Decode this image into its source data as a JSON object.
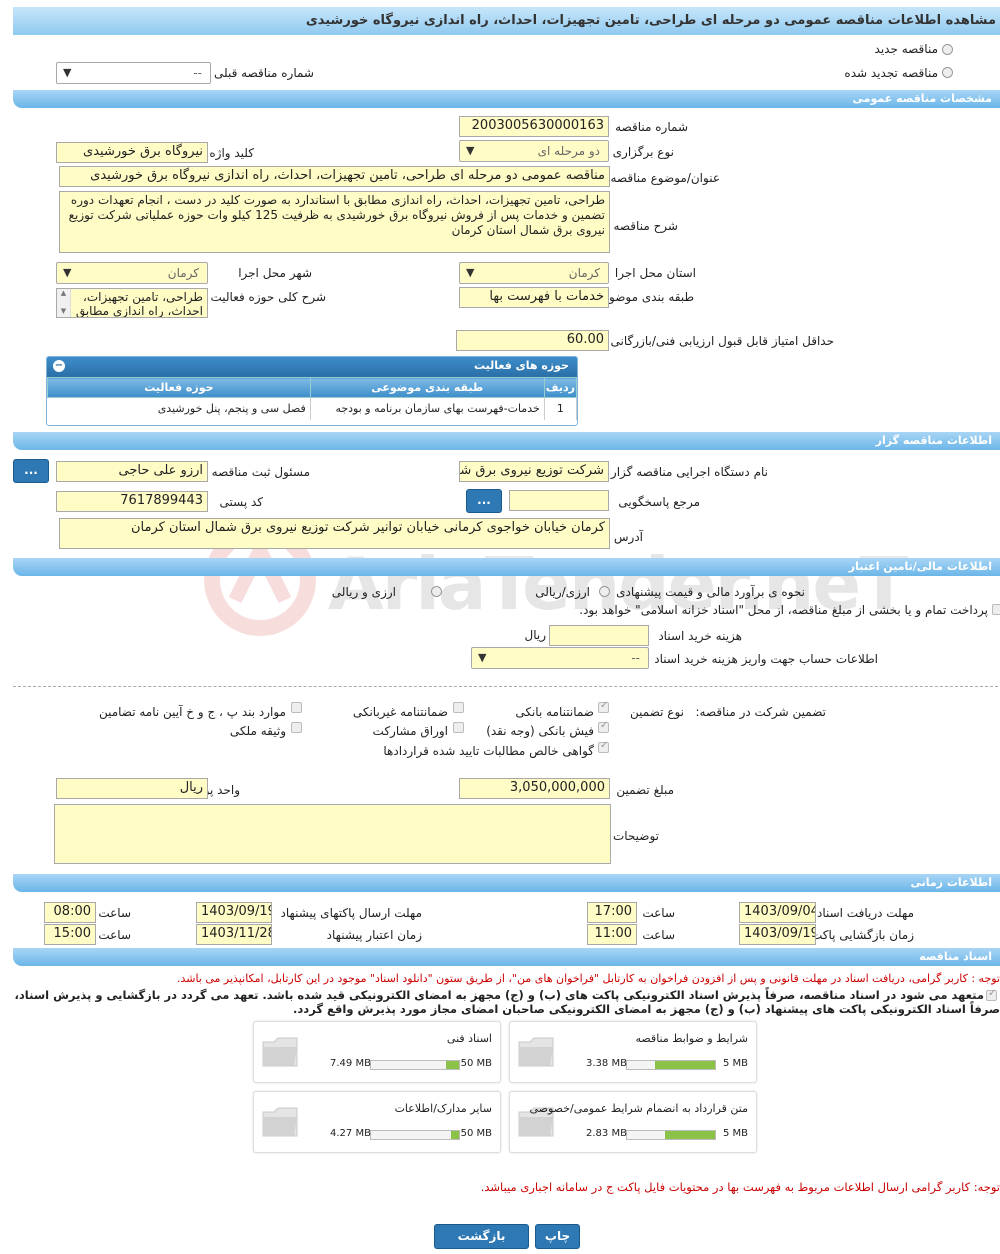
{
  "title": "مشاهده اطلاعات مناقصه عمومی دو مرحله ای طراحی، تامین تجهیزات، احداث، راه اندازی نیروگاه خورشیدی",
  "tender_type": {
    "new": "مناقصه جدید",
    "renewed": "مناقصه تجدید شده",
    "prev_label": "شماره مناقصه قبلی",
    "prev_value": "--"
  },
  "general": {
    "header": "مشخصات مناقصه عمومی",
    "number_label": "شماره مناقصه",
    "number": "2003005630000163",
    "holding_label": "نوع برگزاری",
    "holding": "دو مرحله ای",
    "keyword_label": "کلید واژه",
    "keyword": "نیروگاه برق خورشیدی",
    "subject_label": "عنوان/موضوع مناقصه",
    "subject": "مناقصه عمومی دو مرحله ای طراحی، تامین تجهیزات، احداث، راه اندازی نیروگاه برق خورشیدی",
    "desc_label": "شرح مناقصه",
    "desc": "طراحی، تامین تجهیزات، احداث، راه اندازی مطابق با استاندارد به صورت کلید در دست ، انجام تعهدات دوره تضمین و خدمات پس از فروش نیروگاه برق خورشیدی به ظرفیت 125 کیلو وات حوزه عملیاتی شرکت توزیع نیروی برق شمال استان کرمان",
    "province_label": "استان محل اجرا",
    "province": "کرمان",
    "city_label": "شهر محل اجرا",
    "city": "کرمان",
    "category_label": "طبقه بندی موضوعی",
    "category": "خدمات با فهرست بها",
    "activity_label": "شرح کلی حوزه فعالیت",
    "activity": "طراحی، تامین تجهیزات، احداث، راه اندازی مطابق با",
    "minscore_label": "حداقل امتیاز قابل قبول ارزیابی فنی/بازرگانی",
    "minscore": "60.00"
  },
  "activities": {
    "header": "حوزه های فعالیت",
    "columns": [
      "ردیف",
      "طبقه بندی موضوعی",
      "حوزه فعالیت"
    ],
    "rows": [
      [
        "1",
        "خدمات-فهرست بهای سازمان برنامه و بودجه",
        "فصل سی و پنجم، پنل خورشیدی"
      ]
    ]
  },
  "organizer": {
    "header": "اطلاعات مناقصه گزار",
    "org_label": "نام دستگاه اجرایی مناقصه گزار",
    "org": "شرکت توزیع نیروی برق شمال استان کرمان",
    "resp_label": "مسئول ثبت مناقصه",
    "resp": "ارزو علی حاجی",
    "ref_label": "مرجع پاسخگویی",
    "ref": "",
    "postal_label": "کد پستی",
    "postal": "7617899443",
    "addr_label": "آدرس",
    "addr": "کرمان خیابان خواجوی کرمانی خیابان توانیر شرکت توزیع نیروی برق شمال استان کرمان",
    "btn": "..."
  },
  "finance": {
    "header": "اطلاعات مالی/تامین اعتبار",
    "estimate_label": "نحوه ی برآورد مالی و قیمت پیشنهادی",
    "opt1": "ارزی/ریالی",
    "opt2": "ارزی و ریالی",
    "treasury": "پرداخت تمام و یا بخشی از مبلغ مناقصه، از محل \"اسناد خزانه اسلامی\" خواهد بود.",
    "doc_cost_label": "هزینه خرید اسناد",
    "doc_cost_unit": "ریال",
    "account_label": "اطلاعات حساب جهت واریز هزینه خرید اسناد",
    "account": "--",
    "guarantee_label": "تضمین شرکت در مناقصه:",
    "gtype_label": "نوع تضمین",
    "g1": "ضمانتنامه بانکی",
    "g2": "ضمانتنامه غیربانکی",
    "g3": "موارد بند پ ، ج و خ آیین نامه تضامین",
    "g4": "فیش بانکی (وجه نقد)",
    "g5": "اوراق مشارکت",
    "g6": "وثیقه ملکی",
    "g7": "گواهی خالص مطالبات تایید شده قراردادها",
    "amount_label": "مبلغ تضمین",
    "amount": "3,050,000,000",
    "currency_label": "واحد پول",
    "currency": "ریال",
    "notes_label": "توضیحات"
  },
  "timing": {
    "header": "اطلاعات زمانی",
    "recv_label": "مهلت دریافت اسناد",
    "recv_date": "1403/09/04",
    "time_label": "ساعت",
    "recv_time": "17:00",
    "send_label": "مهلت ارسال پاکتهای پیشنهاد",
    "send_date": "1403/09/19",
    "send_time": "08:00",
    "open_label": "زمان بازگشایی پاکت ها",
    "open_date": "1403/09/19",
    "open_time": "11:00",
    "valid_label": "زمان اعتبار پیشنهاد",
    "valid_date": "1403/11/28",
    "valid_time": "15:00"
  },
  "docs": {
    "header": "اسناد مناقصه",
    "note1": "توجه : کاربر گرامی، دریافت اسناد در مهلت قانونی و پس از افزودن فراخوان به کارتابل \"فراخوان های من\"، از طریق ستون \"دانلود اسناد\" موجود در این کارتابل، امکانپذیر می باشد.",
    "commit1": "متعهد می شود در اسناد مناقصه، صرفاً پذیرش اسناد الکترونیکی پاکت های (ب) و (ج) مجهز به امضای الکترونیکی قید شده باشد. تعهد می گردد در بازگشایی و پذیرش اسناد،",
    "commit2": "صرفاً اسناد الکترونیکی پاکت های پیشنهاد (ب) و (ج) مجهز به امضای الکترونیکی صاحبان امضای مجاز مورد پذیرش واقع گردد.",
    "files": [
      {
        "name": "شرایط و ضوابط مناقصه",
        "max": "5 MB",
        "size": "3.38 MB",
        "pct": 0.68
      },
      {
        "name": "اسناد فنی",
        "max": "50 MB",
        "size": "7.49 MB",
        "pct": 0.15
      },
      {
        "name": "متن قرارداد به انضمام شرایط عمومی/خصوصی",
        "max": "5 MB",
        "size": "2.83 MB",
        "pct": 0.57
      },
      {
        "name": "سایر مدارک/اطلاعات",
        "max": "50 MB",
        "size": "4.27 MB",
        "pct": 0.09
      }
    ],
    "note2": "توجه: کاربر گرامی ارسال اطلاعات مربوط به فهرست بها در محتویات فایل پاکت ج در سامانه اجباری میباشد."
  },
  "buttons": {
    "print": "چاپ",
    "back": "بازگشت"
  },
  "watermark": "AriaTender.neT"
}
